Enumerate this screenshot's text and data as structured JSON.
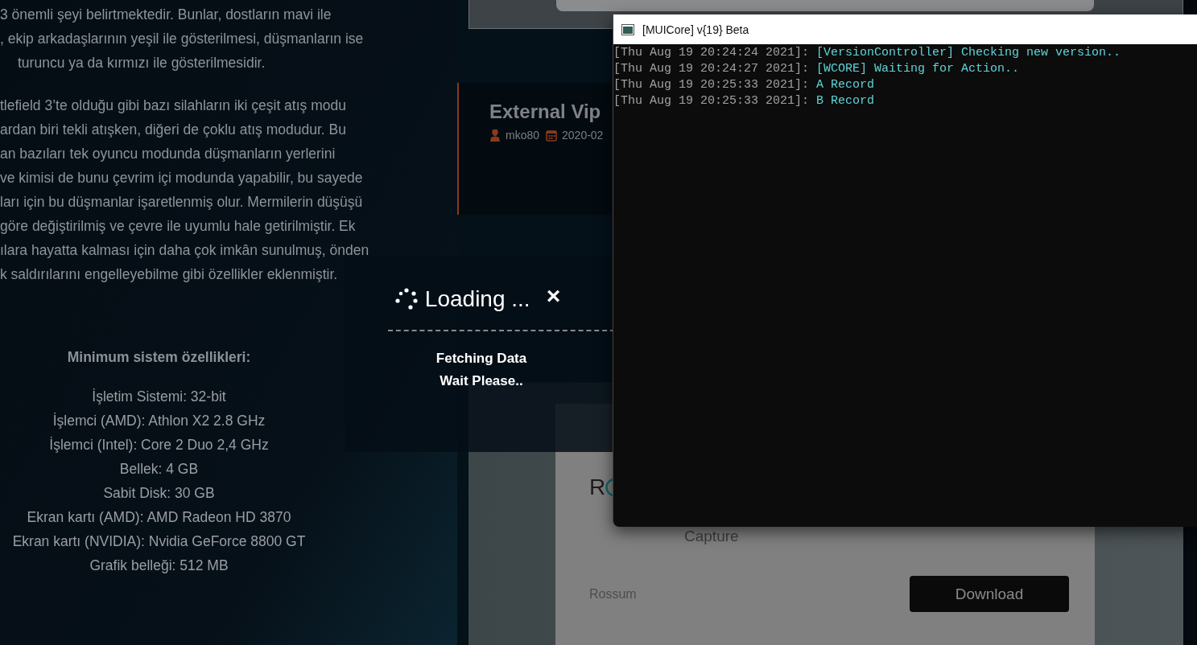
{
  "article": {
    "paragraphs": [
      [
        "3 önemli şeyi belirtmektedir. Bunlar, dostların mavi ile",
        ", ekip arkadaşlarının yeşil ile gösterilmesi, düşmanların ise",
        "turuncu ya da kırmızı ile gösterilmesidir."
      ],
      [
        "tlefield 3’te olduğu gibi bazı silahların iki çeşit atış modu",
        "ardan biri tekli atışken, diğeri de çoklu atış modudur. Bu",
        "an bazıları tek oyuncu modunda düşmanların yerlerini",
        "ve kimisi de bunu çevrim içi modunda yapabilir, bu sayede",
        "ları için bu düşmanlar işaretlenmiş olur. Mermilerin düşüşü",
        "göre değiştirilmiş ve çevre ile uyumlu hale getirilmiştir. Ek",
        "ılara hayatta kalması için daha çok imkân sunulmuş, önden",
        "k saldırılarını engelleyebilme gibi özellikler eklenmiştir."
      ]
    ],
    "requirements_title": "Minimum sistem özellikleri:",
    "requirements": [
      "İşletim Sistemi: 32-bit",
      "İşlemci (AMD): Athlon X2 2.8 GHz",
      "İşlemci (Intel): Core 2 Duo 2,4 GHz",
      "Bellek: 4 GB",
      "Sabit Disk: 30 GB",
      "Ekran kartı (AMD): AMD Radeon HD 3870",
      "Ekran kartı (NVIDIA): Nvidia GeForce 8800 GT",
      "Grafik belleği: 512 MB"
    ]
  },
  "post_card": {
    "title": "External Vip",
    "author": "mko80",
    "date": "2020-02"
  },
  "app_card": {
    "logo": "R",
    "caption": "Capture",
    "vendor": "Rossum",
    "button": "Download"
  },
  "loading_dialog": {
    "title": "Loading ...",
    "close": "×",
    "message": [
      "Fetching Data",
      "Wait Please.."
    ]
  },
  "console_window": {
    "title": "[MUICore] v{19} Beta",
    "lines": [
      {
        "timestamp": "[Thu Aug 19 20:24:24 2021]:",
        "message": "[VersionController] Checking new version.."
      },
      {
        "timestamp": "[Thu Aug 19 20:24:27 2021]:",
        "message": "[WCORE] Waiting for Action.."
      },
      {
        "timestamp": "[Thu Aug 19 20:25:33 2021]:",
        "message": "A Record"
      },
      {
        "timestamp": "[Thu Aug 19 20:25:33 2021]:",
        "message": "B Record"
      }
    ]
  }
}
